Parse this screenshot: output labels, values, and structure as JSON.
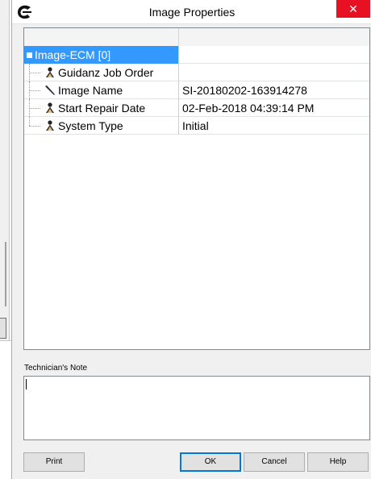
{
  "window": {
    "title": "Image Properties",
    "close_glyph": "✕",
    "logo_icon": "cummins-logo-icon"
  },
  "grid": {
    "root": {
      "toggle_icon": "collapse-box-icon",
      "label": "Image-ECM [0]"
    },
    "properties": [
      {
        "icon": "person-read-only-icon",
        "label": "Guidanz Job Order",
        "value": ""
      },
      {
        "icon": "pencil-editable-icon",
        "label": "Image Name",
        "value": "SI-20180202-163914278"
      },
      {
        "icon": "person-read-only-icon",
        "label": "Start Repair Date",
        "value": "02-Feb-2018 04:39:14 PM"
      },
      {
        "icon": "person-read-only-icon",
        "label": "System Type",
        "value": "Initial"
      }
    ]
  },
  "note": {
    "label": "Technician's Note",
    "value": ""
  },
  "buttons": {
    "print": "Print",
    "ok": "OK",
    "cancel": "Cancel",
    "help": "Help"
  },
  "colors": {
    "selection": "#3399ff",
    "close": "#e81123",
    "default_button_border": "#0078d7"
  }
}
